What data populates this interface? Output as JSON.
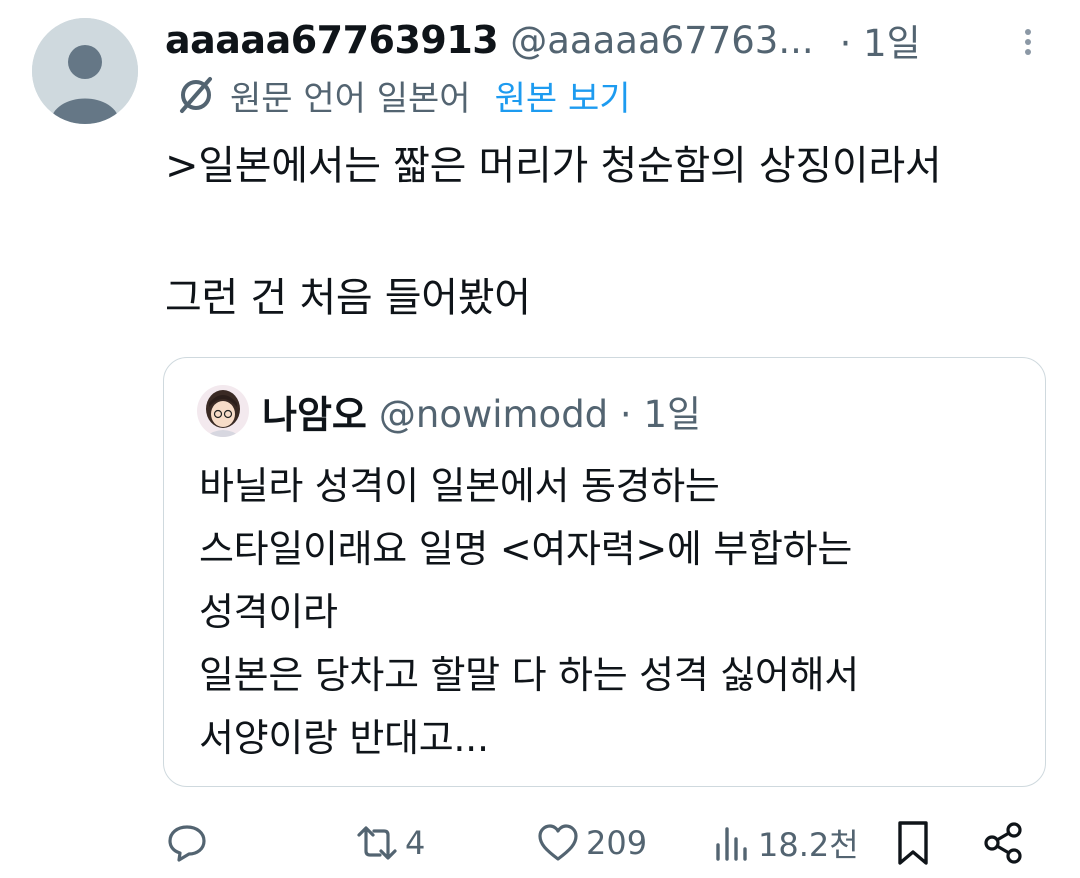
{
  "post": {
    "display_name": "aaaaa67763913",
    "handle": "@aaaaa67763...",
    "time": "· 1일",
    "avatar_icon": "default-avatar-icon",
    "more_icon": "more-vertical-icon"
  },
  "translation": {
    "icon": "translate-icon",
    "label": "원문 언어 일본어",
    "show_original": "원본 보기"
  },
  "body": {
    "line1": ">일본에서는 짧은 머리가 청순함의 상징이라서",
    "line2": "그런 건 처음 들어봤어"
  },
  "quote": {
    "display_name": "나암오",
    "handle_time": "@nowimodd · 1일",
    "avatar_icon": "anime-avatar-icon",
    "lines": [
      "바닐라 성격이 일본에서 동경하는",
      "스타일이래요 일명 <여자력>에 부합하는",
      "성격이라",
      "일본은 당차고 할말 다 하는 성격 싫어해서",
      "서양이랑 반대고..."
    ]
  },
  "actions": {
    "reply": {
      "icon": "reply-icon",
      "count": ""
    },
    "repost": {
      "icon": "repost-icon",
      "count": "4"
    },
    "like": {
      "icon": "heart-icon",
      "count": "209"
    },
    "views": {
      "icon": "views-icon",
      "count": "18.2천"
    },
    "bookmark": {
      "icon": "bookmark-icon"
    },
    "share": {
      "icon": "share-icon"
    }
  },
  "colors": {
    "text": "#0f1419",
    "secondary": "#536471",
    "link": "#1d9bf0",
    "border": "#cfd9de"
  }
}
